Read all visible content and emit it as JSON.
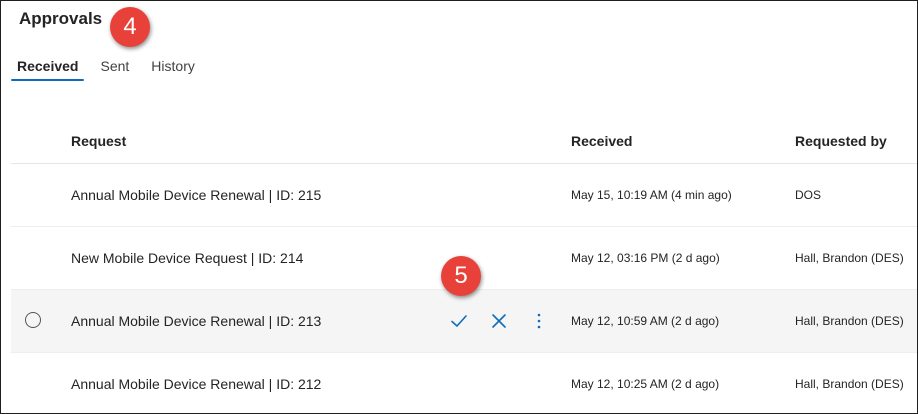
{
  "page": {
    "title": "Approvals"
  },
  "callouts": [
    "4",
    "5"
  ],
  "tabs": [
    {
      "label": "Received",
      "active": true
    },
    {
      "label": "Sent",
      "active": false
    },
    {
      "label": "History",
      "active": false
    }
  ],
  "table": {
    "columns": {
      "request": "Request",
      "received": "Received",
      "requested_by": "Requested by"
    },
    "rows": [
      {
        "request": "Annual Mobile Device Renewal | ID: 215",
        "received": "May 15, 10:19 AM (4 min ago)",
        "requested_by": "DOS"
      },
      {
        "request": "New Mobile Device Request | ID: 214",
        "received": "May 12, 03:16 PM (2 d ago)",
        "requested_by": "Hall, Brandon (DES)"
      },
      {
        "request": "Annual Mobile Device Renewal | ID: 213",
        "received": "May 12, 10:59 AM (2 d ago)",
        "requested_by": "Hall, Brandon (DES)",
        "hovered": true
      },
      {
        "request": "Annual Mobile Device Renewal | ID: 212",
        "received": "May 12, 10:25 AM (2 d ago)",
        "requested_by": "Hall, Brandon (DES)"
      }
    ]
  },
  "row_actions": [
    {
      "icon": "checkmark-icon"
    },
    {
      "icon": "close-icon"
    },
    {
      "icon": "more-vertical-icon"
    }
  ],
  "colors": {
    "accent": "#0f6cbd",
    "badge": "#e8413a",
    "hover_row": "#f5f5f5"
  }
}
